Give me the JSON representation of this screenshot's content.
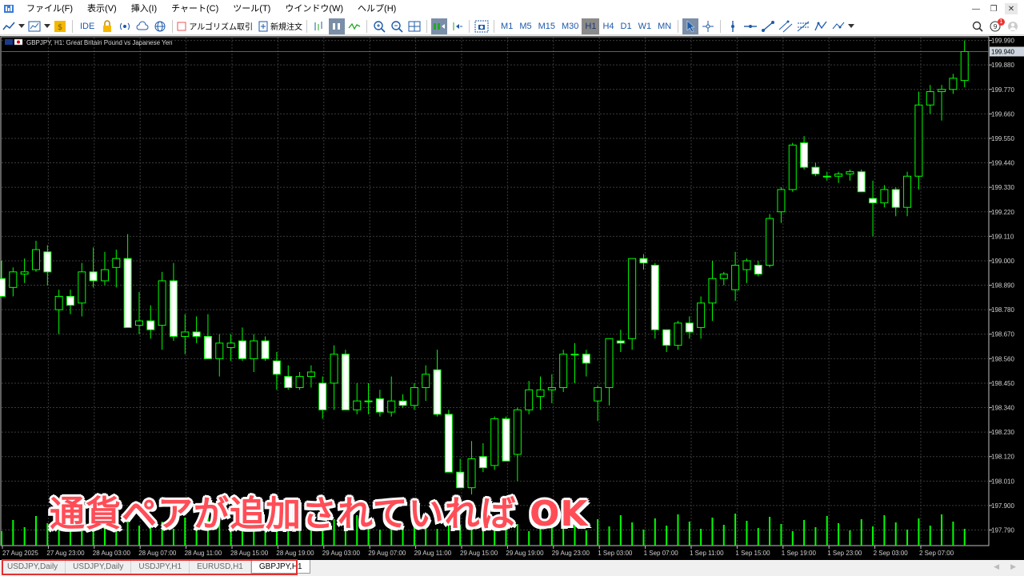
{
  "menu": {
    "items": [
      "ファイル(F)",
      "表示(V)",
      "挿入(I)",
      "チャート(C)",
      "ツール(T)",
      "ウインドウ(W)",
      "ヘルプ(H)"
    ]
  },
  "toolbar": {
    "ide_label": "IDE",
    "algo_label": "アルゴリズム取引",
    "new_order_label": "新規注文",
    "timeframes": [
      "M1",
      "M5",
      "M15",
      "M30",
      "H1",
      "H4",
      "D1",
      "W1",
      "MN"
    ],
    "active_timeframe": "H1",
    "notification_count": "1"
  },
  "chart": {
    "header_label": "GBPJPY, H1:  Great Britain Pound vs Japanese Yen",
    "current_price": "199.940",
    "bull_color": "#00ff00",
    "bear_color": "#ffffff",
    "grid_color": "#3a3a3a"
  },
  "chart_data": {
    "type": "candlestick",
    "title": "GBPJPY, H1:  Great Britain Pound vs Japanese Yen",
    "ylim": [
      197.72,
      200.01
    ],
    "y_ticks": [
      "199.990",
      "199.880",
      "199.770",
      "199.660",
      "199.550",
      "199.440",
      "199.330",
      "199.220",
      "199.110",
      "199.000",
      "198.890",
      "198.780",
      "198.670",
      "198.560",
      "198.450",
      "198.340",
      "198.230",
      "198.120",
      "198.010",
      "197.900",
      "197.790"
    ],
    "x_ticks": [
      "27 Aug 2025",
      "27 Aug 23:00",
      "28 Aug 03:00",
      "28 Aug 07:00",
      "28 Aug 11:00",
      "28 Aug 15:00",
      "28 Aug 19:00",
      "29 Aug 03:00",
      "29 Aug 07:00",
      "29 Aug 11:00",
      "29 Aug 15:00",
      "29 Aug 19:00",
      "29 Aug 23:00",
      "1 Sep 03:00",
      "1 Sep 07:00",
      "1 Sep 11:00",
      "1 Sep 15:00",
      "1 Sep 19:00",
      "1 Sep 23:00",
      "2 Sep 03:00",
      "2 Sep 07:00"
    ],
    "candles": [
      {
        "o": 198.92,
        "h": 199.0,
        "l": 198.86,
        "c": 198.84
      },
      {
        "o": 198.88,
        "h": 198.97,
        "l": 198.84,
        "c": 198.95
      },
      {
        "o": 198.94,
        "h": 199.01,
        "l": 198.9,
        "c": 198.95
      },
      {
        "o": 198.96,
        "h": 199.09,
        "l": 198.95,
        "c": 199.05
      },
      {
        "o": 199.04,
        "h": 199.07,
        "l": 198.89,
        "c": 198.95
      },
      {
        "o": 198.78,
        "h": 198.87,
        "l": 198.67,
        "c": 198.84
      },
      {
        "o": 198.84,
        "h": 198.87,
        "l": 198.76,
        "c": 198.8
      },
      {
        "o": 198.81,
        "h": 198.99,
        "l": 198.75,
        "c": 198.95
      },
      {
        "o": 198.95,
        "h": 199.06,
        "l": 198.88,
        "c": 198.91
      },
      {
        "o": 198.91,
        "h": 199.04,
        "l": 198.89,
        "c": 198.96
      },
      {
        "o": 198.97,
        "h": 199.05,
        "l": 198.88,
        "c": 199.01
      },
      {
        "o": 199.01,
        "h": 199.12,
        "l": 198.93,
        "c": 198.7
      },
      {
        "o": 198.71,
        "h": 198.86,
        "l": 198.67,
        "c": 198.73
      },
      {
        "o": 198.73,
        "h": 198.8,
        "l": 198.65,
        "c": 198.69
      },
      {
        "o": 198.71,
        "h": 198.95,
        "l": 198.6,
        "c": 198.91
      },
      {
        "o": 198.91,
        "h": 198.99,
        "l": 198.64,
        "c": 198.66
      },
      {
        "o": 198.66,
        "h": 198.76,
        "l": 198.58,
        "c": 198.68
      },
      {
        "o": 198.68,
        "h": 198.75,
        "l": 198.63,
        "c": 198.66
      },
      {
        "o": 198.66,
        "h": 198.76,
        "l": 198.59,
        "c": 198.56
      },
      {
        "o": 198.56,
        "h": 198.67,
        "l": 198.48,
        "c": 198.63
      },
      {
        "o": 198.61,
        "h": 198.67,
        "l": 198.55,
        "c": 198.63
      },
      {
        "o": 198.64,
        "h": 198.7,
        "l": 198.55,
        "c": 198.56
      },
      {
        "o": 198.56,
        "h": 198.67,
        "l": 198.5,
        "c": 198.64
      },
      {
        "o": 198.64,
        "h": 198.66,
        "l": 198.55,
        "c": 198.56
      },
      {
        "o": 198.55,
        "h": 198.59,
        "l": 198.42,
        "c": 198.49
      },
      {
        "o": 198.48,
        "h": 198.53,
        "l": 198.42,
        "c": 198.43
      },
      {
        "o": 198.43,
        "h": 198.5,
        "l": 198.42,
        "c": 198.48
      },
      {
        "o": 198.48,
        "h": 198.53,
        "l": 198.43,
        "c": 198.5
      },
      {
        "o": 198.45,
        "h": 198.48,
        "l": 198.29,
        "c": 198.33
      },
      {
        "o": 198.45,
        "h": 198.62,
        "l": 198.33,
        "c": 198.58
      },
      {
        "o": 198.58,
        "h": 198.6,
        "l": 198.33,
        "c": 198.33
      },
      {
        "o": 198.33,
        "h": 198.45,
        "l": 198.31,
        "c": 198.37
      },
      {
        "o": 198.37,
        "h": 198.45,
        "l": 198.31,
        "c": 198.37
      },
      {
        "o": 198.38,
        "h": 198.42,
        "l": 198.3,
        "c": 198.32
      },
      {
        "o": 198.32,
        "h": 198.48,
        "l": 198.3,
        "c": 198.37
      },
      {
        "o": 198.37,
        "h": 198.4,
        "l": 198.34,
        "c": 198.35
      },
      {
        "o": 198.35,
        "h": 198.45,
        "l": 198.33,
        "c": 198.43
      },
      {
        "o": 198.43,
        "h": 198.53,
        "l": 198.37,
        "c": 198.49
      },
      {
        "o": 198.51,
        "h": 198.6,
        "l": 198.3,
        "c": 198.31
      },
      {
        "o": 198.31,
        "h": 198.33,
        "l": 198.06,
        "c": 198.05
      },
      {
        "o": 198.05,
        "h": 198.11,
        "l": 197.98,
        "c": 197.98
      },
      {
        "o": 197.98,
        "h": 198.19,
        "l": 197.95,
        "c": 198.11
      },
      {
        "o": 198.12,
        "h": 198.18,
        "l": 198.05,
        "c": 198.07
      },
      {
        "o": 198.08,
        "h": 198.3,
        "l": 198.06,
        "c": 198.29
      },
      {
        "o": 198.29,
        "h": 198.3,
        "l": 198.12,
        "c": 198.1
      },
      {
        "o": 198.13,
        "h": 198.34,
        "l": 198.01,
        "c": 198.33
      },
      {
        "o": 198.33,
        "h": 198.46,
        "l": 198.31,
        "c": 198.42
      },
      {
        "o": 198.39,
        "h": 198.48,
        "l": 198.33,
        "c": 198.42
      },
      {
        "o": 198.42,
        "h": 198.49,
        "l": 198.36,
        "c": 198.43
      },
      {
        "o": 198.43,
        "h": 198.6,
        "l": 198.41,
        "c": 198.58
      },
      {
        "o": 198.58,
        "h": 198.63,
        "l": 198.45,
        "c": 198.58
      },
      {
        "o": 198.58,
        "h": 198.6,
        "l": 198.48,
        "c": 198.54
      },
      {
        "o": 198.37,
        "h": 198.44,
        "l": 198.28,
        "c": 198.43
      },
      {
        "o": 198.43,
        "h": 198.6,
        "l": 198.35,
        "c": 198.65
      },
      {
        "o": 198.64,
        "h": 198.69,
        "l": 198.59,
        "c": 198.63
      },
      {
        "o": 198.65,
        "h": 199.01,
        "l": 198.6,
        "c": 199.01
      },
      {
        "o": 199.01,
        "h": 199.03,
        "l": 198.96,
        "c": 198.99
      },
      {
        "o": 198.98,
        "h": 198.99,
        "l": 198.65,
        "c": 198.69
      },
      {
        "o": 198.69,
        "h": 198.69,
        "l": 198.59,
        "c": 198.62
      },
      {
        "o": 198.62,
        "h": 198.73,
        "l": 198.6,
        "c": 198.72
      },
      {
        "o": 198.72,
        "h": 198.75,
        "l": 198.65,
        "c": 198.68
      },
      {
        "o": 198.7,
        "h": 198.84,
        "l": 198.65,
        "c": 198.81
      },
      {
        "o": 198.81,
        "h": 199.0,
        "l": 198.73,
        "c": 198.92
      },
      {
        "o": 198.92,
        "h": 198.95,
        "l": 198.89,
        "c": 198.94
      },
      {
        "o": 198.87,
        "h": 199.04,
        "l": 198.82,
        "c": 198.98
      },
      {
        "o": 198.96,
        "h": 199.01,
        "l": 198.9,
        "c": 199.0
      },
      {
        "o": 198.98,
        "h": 199.0,
        "l": 198.93,
        "c": 198.94
      },
      {
        "o": 198.98,
        "h": 199.21,
        "l": 198.97,
        "c": 199.19
      },
      {
        "o": 199.22,
        "h": 199.33,
        "l": 199.17,
        "c": 199.32
      },
      {
        "o": 199.32,
        "h": 199.53,
        "l": 199.31,
        "c": 199.52
      },
      {
        "o": 199.53,
        "h": 199.56,
        "l": 199.41,
        "c": 199.42
      },
      {
        "o": 199.42,
        "h": 199.44,
        "l": 199.38,
        "c": 199.39
      },
      {
        "o": 199.38,
        "h": 199.4,
        "l": 199.36,
        "c": 199.38
      },
      {
        "o": 199.38,
        "h": 199.4,
        "l": 199.35,
        "c": 199.39
      },
      {
        "o": 199.39,
        "h": 199.41,
        "l": 199.36,
        "c": 199.4
      },
      {
        "o": 199.4,
        "h": 199.41,
        "l": 199.31,
        "c": 199.31
      },
      {
        "o": 199.28,
        "h": 199.36,
        "l": 199.11,
        "c": 199.26
      },
      {
        "o": 199.26,
        "h": 199.34,
        "l": 199.24,
        "c": 199.32
      },
      {
        "o": 199.32,
        "h": 199.33,
        "l": 199.2,
        "c": 199.24
      },
      {
        "o": 199.24,
        "h": 199.4,
        "l": 199.2,
        "c": 199.38
      },
      {
        "o": 199.38,
        "h": 199.76,
        "l": 199.32,
        "c": 199.7
      },
      {
        "o": 199.7,
        "h": 199.79,
        "l": 199.66,
        "c": 199.76
      },
      {
        "o": 199.76,
        "h": 199.79,
        "l": 199.63,
        "c": 199.77
      },
      {
        "o": 199.77,
        "h": 199.84,
        "l": 199.75,
        "c": 199.82
      },
      {
        "o": 199.81,
        "h": 199.99,
        "l": 199.78,
        "c": 199.94
      }
    ],
    "volume_note": "tick volume histogram"
  },
  "overlay": {
    "caption": "通貨ペアが追加されていれば OK"
  },
  "tabs": [
    {
      "label": "USDJPY,Daily",
      "active": false
    },
    {
      "label": "USDJPY,Daily",
      "active": false
    },
    {
      "label": "USDJPY,H1",
      "active": false
    },
    {
      "label": "EURUSD,H1",
      "active": false
    },
    {
      "label": "GBPJPY,H1",
      "active": true
    }
  ],
  "colors": {
    "highlight_border": "#e53030",
    "caption_fill": "#ff4d57",
    "caption_stroke": "#ffffff"
  }
}
